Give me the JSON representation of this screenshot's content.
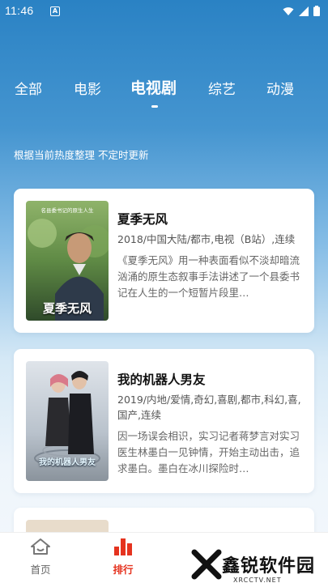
{
  "status_bar": {
    "time": "11:46",
    "notif": "A"
  },
  "tabs": [
    {
      "label": "全部"
    },
    {
      "label": "电影"
    },
    {
      "label": "电视剧"
    },
    {
      "label": "综艺"
    },
    {
      "label": "动漫"
    }
  ],
  "subtitle": "根据当前热度整理 不定时更新",
  "cards": [
    {
      "title": "夏季无风",
      "meta": "2018/中国大陆/都市,电视（B站）,连续",
      "desc": "《夏季无风》用一种表面看似不淡却暗流汹涌的原生态叙事手法讲述了一个县委书记在人生的一个短暂片段里…",
      "poster_title": "夏季无风",
      "poster_caption": "名县委书记的原生人生"
    },
    {
      "title": "我的机器人男友",
      "meta": "2019/内地/爱情,奇幻,喜剧,都市,科幻,喜,国产,连续",
      "desc": "因一场误会相识，实习记者蒋梦言对实习医生林墨白一见钟情，开始主动出击，追求墨白。墨白在冰川探险时…",
      "poster_title": "我的机器人男友"
    }
  ],
  "nav": {
    "home": "首页",
    "rank": "排行"
  },
  "watermark": {
    "text": "鑫锐软件园",
    "sub": "XRCCTV.NET"
  },
  "colors": {
    "accent": "#e5331f",
    "header_blue": "#2a82c4"
  }
}
